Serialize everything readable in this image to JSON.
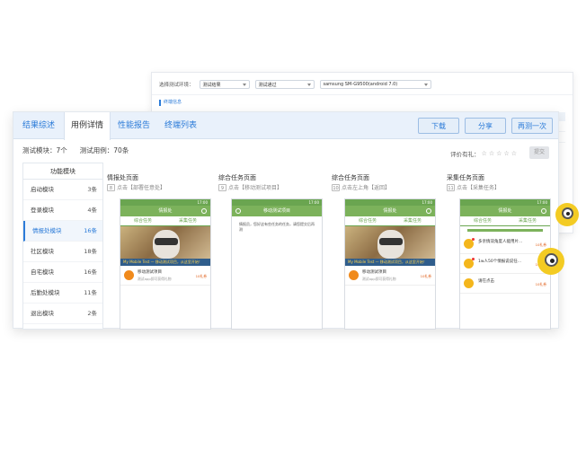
{
  "filters": {
    "label": "选择测试环境：",
    "select1": "测试结果",
    "select2": "测试通过",
    "device": "samsung SM-G9500(android 7.0)"
  },
  "back_section_label": "终端信息",
  "tabs": [
    {
      "label": "结果综述"
    },
    {
      "label": "用例详情"
    },
    {
      "label": "性能报告"
    },
    {
      "label": "终端列表"
    }
  ],
  "buttons": {
    "download": "下载",
    "share": "分享",
    "retest": "再测一次"
  },
  "stats": {
    "modules": "测试模块：7个",
    "cases": "测试用例：70条"
  },
  "rating": {
    "label": "评价有礼：",
    "stars": 5,
    "submit": "提交"
  },
  "sidebar": {
    "header": "功能模块",
    "items": [
      {
        "label": "启动模块",
        "count": "3条"
      },
      {
        "label": "登录模块",
        "count": "4条"
      },
      {
        "label": "情报处模块",
        "count": "16条"
      },
      {
        "label": "社区模块",
        "count": "18条"
      },
      {
        "label": "自宅模块",
        "count": "16条"
      },
      {
        "label": "后勤处模块",
        "count": "11条"
      },
      {
        "label": "退出模块",
        "count": "2条"
      }
    ]
  },
  "columns": [
    {
      "title": "情报处页面",
      "step_num": "8",
      "step": "点击【部署任意处】"
    },
    {
      "title": "综合任务页面",
      "step_num": "9",
      "step": "点击【移动测试项目】"
    },
    {
      "title": "综合任务页面",
      "step_num": "10",
      "step": "点击左上角【返回】"
    },
    {
      "title": "采集任务页面",
      "step_num": "11",
      "step": "点击【采集任务】"
    }
  ],
  "phone": {
    "time": "17:00",
    "screen1_title": "情报处",
    "screen2_title": "移动测试项目",
    "screen3_title": "情报处",
    "screen4_title": "情报处",
    "tab_a": "综合任务",
    "tab_b": "采集任务",
    "banner_text": "My Mobile Test — 移动测试项目，从这里开始！",
    "item_title": "移动测试项目",
    "item_sub": "测试app即可获得礼物",
    "item_reward": "10礼券",
    "message": "情报员，您好这有些任务的任务，请您提交后再测",
    "tasks": [
      {
        "text": "多亲情双角度人能用片...",
        "reward": "10礼券"
      },
      {
        "text": "1w人50个情报说说任...",
        "reward": "10礼券"
      },
      {
        "text": "请在点击",
        "reward": "10礼券"
      }
    ]
  },
  "colors": {
    "accent": "#2b7bd8",
    "tab_bg": "#e9f1fb",
    "phone_green": "#7cb25b",
    "minion_yellow": "#f3cb23"
  }
}
